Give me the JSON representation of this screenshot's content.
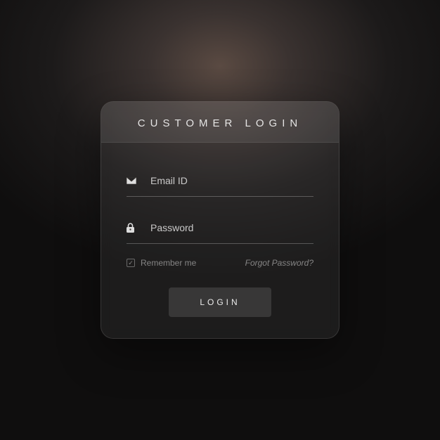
{
  "header": {
    "title": "CUSTOMER LOGIN"
  },
  "form": {
    "email": {
      "placeholder": "Email ID",
      "value": ""
    },
    "password": {
      "placeholder": "Password",
      "value": ""
    },
    "remember": {
      "label": "Remember me",
      "checked": true
    },
    "forgot_label": "Forgot Password?",
    "submit_label": "LOGIN"
  },
  "icons": {
    "email": "mail-icon",
    "password": "lock-icon",
    "check": "✓"
  }
}
